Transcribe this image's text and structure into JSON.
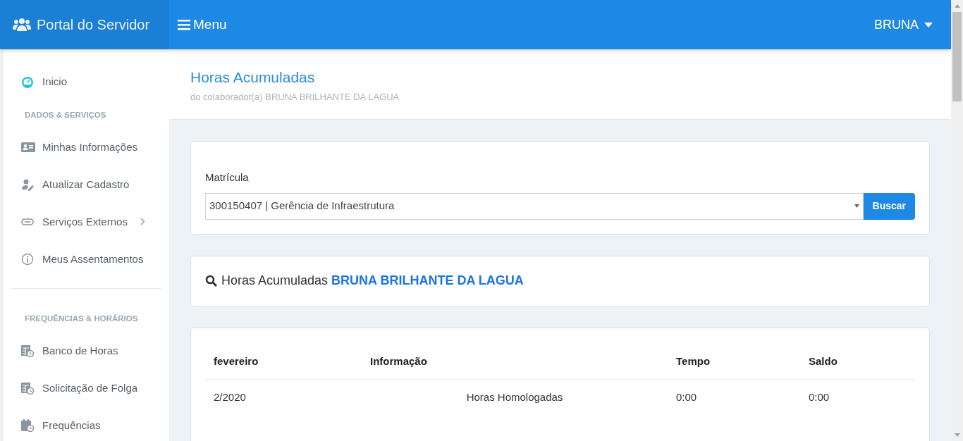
{
  "header": {
    "brand": "Portal do Servidor",
    "menu": "Menu",
    "user": "BRUNA"
  },
  "sidebar": {
    "items": [
      {
        "kind": "link",
        "label": "Inicio"
      },
      {
        "kind": "heading",
        "label": "DADOS & SERVIÇOS"
      },
      {
        "kind": "link",
        "label": "Minhas Informações"
      },
      {
        "kind": "link",
        "label": "Atualizar Cadastro"
      },
      {
        "kind": "link",
        "label": "Serviços Externos",
        "submenu": true
      },
      {
        "kind": "link",
        "label": "Meus Assentamentos"
      },
      {
        "kind": "divider"
      },
      {
        "kind": "heading",
        "label": "FREQUÊNCIAS & HORÁRIOS"
      },
      {
        "kind": "link",
        "label": "Banco de Horas"
      },
      {
        "kind": "link",
        "label": "Solicitação de Folga"
      },
      {
        "kind": "link",
        "label": "Frequências"
      }
    ]
  },
  "page": {
    "title": "Horas Acumuladas",
    "subtitle": "do colaborador(a) BRUNA BRILHANTE DA LAGUA"
  },
  "form": {
    "label": "Matrícula",
    "value": "300150407 | Gerência de Infraestrutura",
    "button": "Buscar"
  },
  "result": {
    "title": "Horas Acumuladas **BRUNA BRILHANTE DA LAGUA**"
  },
  "table": {
    "columns": [
      "fevereiro",
      "Informação",
      "Tempo",
      "Saldo"
    ],
    "rows": [
      [
        "2/2020",
        "Horas Homologadas",
        "0:00",
        "0:00"
      ]
    ]
  }
}
